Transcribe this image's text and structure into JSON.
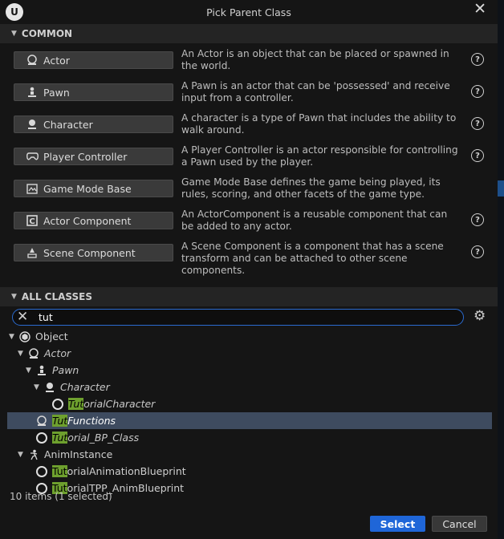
{
  "window": {
    "title": "Pick Parent Class",
    "logo": "U",
    "close_glyph": "✕"
  },
  "common": {
    "header": "COMMON",
    "items": [
      {
        "label": "Actor",
        "icon": "actor-sphere-icon",
        "desc": "An Actor is an object that can be placed or spawned in the world."
      },
      {
        "label": "Pawn",
        "icon": "pawn-icon",
        "desc": "A Pawn is an actor that can be 'possessed' and receive input from a controller."
      },
      {
        "label": "Character",
        "icon": "character-icon",
        "desc": "A character is a type of Pawn that includes the ability to walk around."
      },
      {
        "label": "Player Controller",
        "icon": "gamepad-icon",
        "desc": "A Player Controller is an actor responsible for controlling a Pawn used by the player."
      },
      {
        "label": "Game Mode Base",
        "icon": "game-mode-icon",
        "desc": "Game Mode Base defines the game being played, its rules, scoring, and other facets of the game type."
      },
      {
        "label": "Actor Component",
        "icon": "actor-component-icon",
        "desc": "An ActorComponent is a reusable component that can be added to any actor."
      },
      {
        "label": "Scene Component",
        "icon": "scene-component-icon",
        "desc": "A Scene Component is a component that has a scene transform and can be attached to other scene components."
      }
    ]
  },
  "all_classes": {
    "header": "ALL CLASSES",
    "search_value": "tut",
    "tree": {
      "object": "Object",
      "actor": "Actor",
      "pawn": "Pawn",
      "character": "Character",
      "tutorial_character": {
        "match": "Tut",
        "rest": "orialCharacter"
      },
      "tut_functions": {
        "match": "Tut",
        "rest": "Functions"
      },
      "tutorial_bp_class": {
        "match": "Tut",
        "rest": "orial_BP_Class"
      },
      "anim_instance": "AnimInstance",
      "tutorial_anim_bp": {
        "match": "Tut",
        "rest": "orialAnimationBlueprint"
      },
      "tutorial_tpp_anim_bp": {
        "match": "Tut",
        "rest": "orialTPP_AnimBlueprint"
      }
    },
    "status": "10 items (1 selected)"
  },
  "footer": {
    "select_label": "Select",
    "cancel_label": "Cancel"
  },
  "colors": {
    "accent": "#1f66d8",
    "highlight": "#6ea02e",
    "selection": "#3e4b5f"
  }
}
